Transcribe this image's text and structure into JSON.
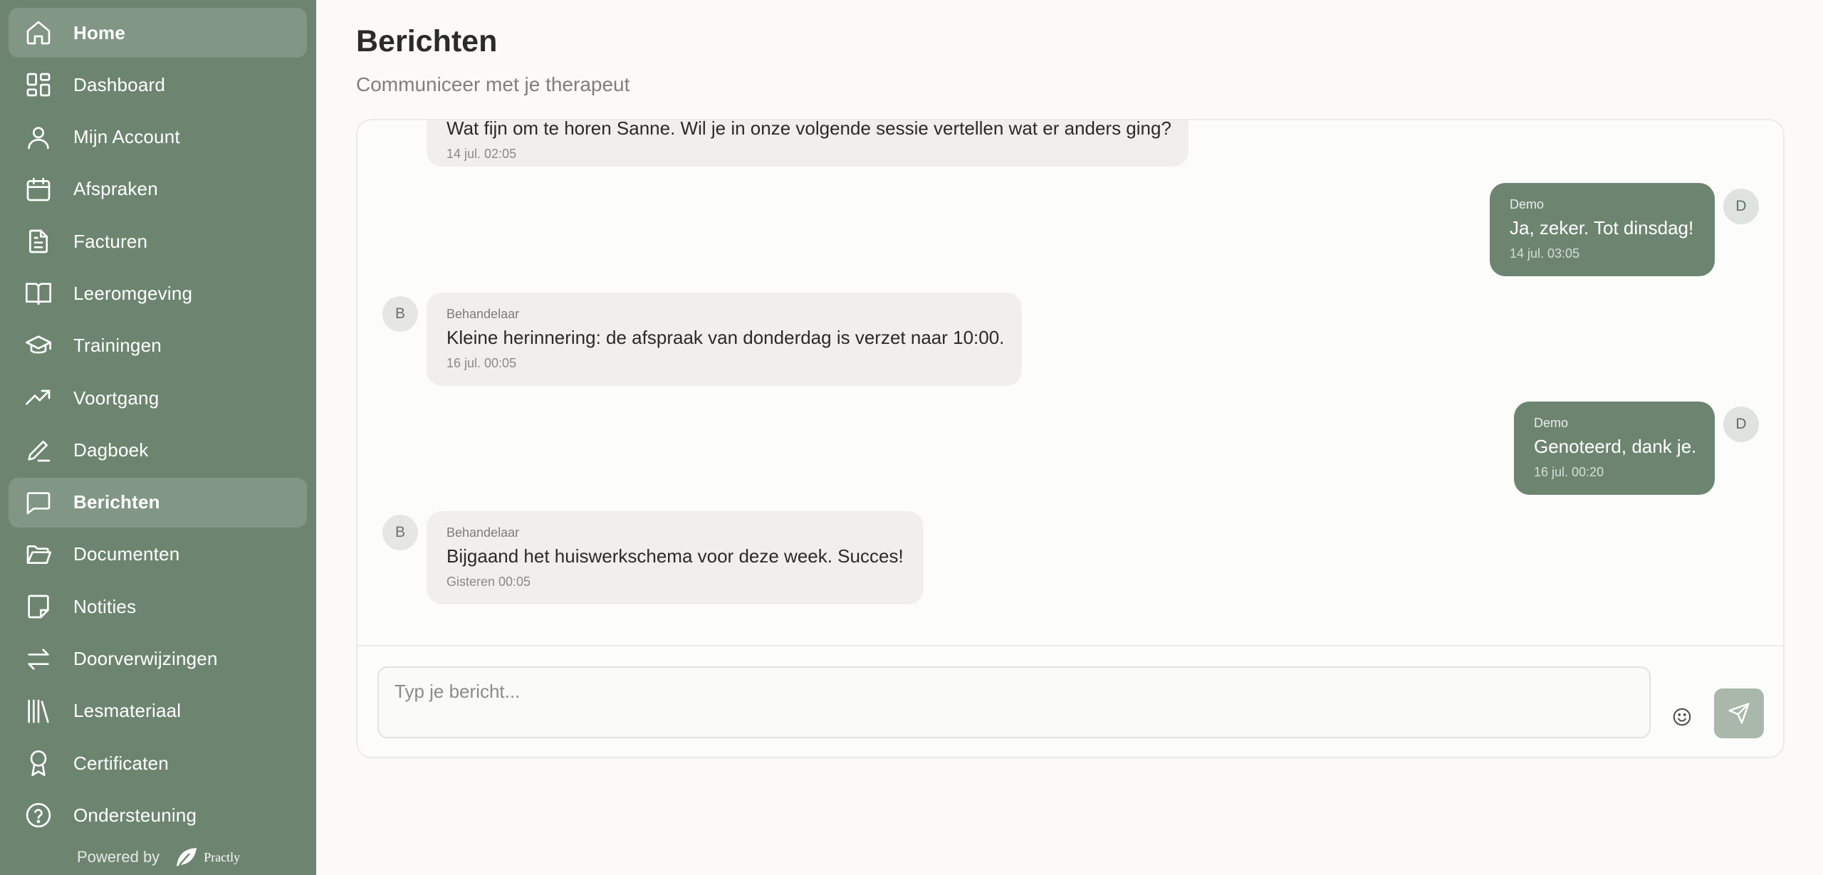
{
  "sidebar": {
    "items": [
      {
        "label": "Home",
        "icon": "home-icon",
        "active": true
      },
      {
        "label": "Dashboard",
        "icon": "dashboard-icon",
        "active": false
      },
      {
        "label": "Mijn Account",
        "icon": "user-icon",
        "active": false
      },
      {
        "label": "Afspraken",
        "icon": "calendar-icon",
        "active": false
      },
      {
        "label": "Facturen",
        "icon": "invoice-icon",
        "active": false
      },
      {
        "label": "Leeromgeving",
        "icon": "book-icon",
        "active": false
      },
      {
        "label": "Trainingen",
        "icon": "graduation-cap-icon",
        "active": false
      },
      {
        "label": "Voortgang",
        "icon": "trending-up-icon",
        "active": false
      },
      {
        "label": "Dagboek",
        "icon": "pen-icon",
        "active": false
      },
      {
        "label": "Berichten",
        "icon": "message-icon",
        "active": true
      },
      {
        "label": "Documenten",
        "icon": "folder-icon",
        "active": false
      },
      {
        "label": "Notities",
        "icon": "note-icon",
        "active": false
      },
      {
        "label": "Doorverwijzingen",
        "icon": "arrows-exchange-icon",
        "active": false
      },
      {
        "label": "Lesmateriaal",
        "icon": "library-icon",
        "active": false
      },
      {
        "label": "Certificaten",
        "icon": "award-icon",
        "active": false
      },
      {
        "label": "Ondersteuning",
        "icon": "help-circle-icon",
        "active": false
      }
    ],
    "powered_by": "Powered by",
    "brand": "Practly"
  },
  "header": {
    "title": "Berichten",
    "subtitle": "Communiceer met je therapeut"
  },
  "messages": [
    {
      "direction": "in",
      "sender": "",
      "avatar": "",
      "text": "Wat fijn om te horen Sanne. Wil je in onze volgende sessie vertellen wat er anders ging?",
      "time": "14 jul. 02:05"
    },
    {
      "direction": "out",
      "sender": "Demo",
      "avatar": "D",
      "text": "Ja, zeker. Tot dinsdag!",
      "time": "14 jul. 03:05"
    },
    {
      "direction": "in",
      "sender": "Behandelaar",
      "avatar": "B",
      "text": "Kleine herinnering: de afspraak van donderdag is verzet naar 10:00.",
      "time": "16 jul. 00:05"
    },
    {
      "direction": "out",
      "sender": "Demo",
      "avatar": "D",
      "text": "Genoteerd, dank je.",
      "time": "16 jul. 00:20"
    },
    {
      "direction": "in",
      "sender": "Behandelaar",
      "avatar": "B",
      "text": "Bijgaand het huiswerkschema voor deze week. Succes!",
      "time": "Gisteren 00:05"
    }
  ],
  "composer": {
    "placeholder": "Typ je bericht...",
    "emoji_icon": "smiley-icon",
    "send_icon": "send-icon"
  },
  "colors": {
    "sidebar": "#6d8570",
    "outgoing_bubble": "#6d8570",
    "incoming_bubble": "#f0efed",
    "send_button": "#a9b8aa"
  }
}
